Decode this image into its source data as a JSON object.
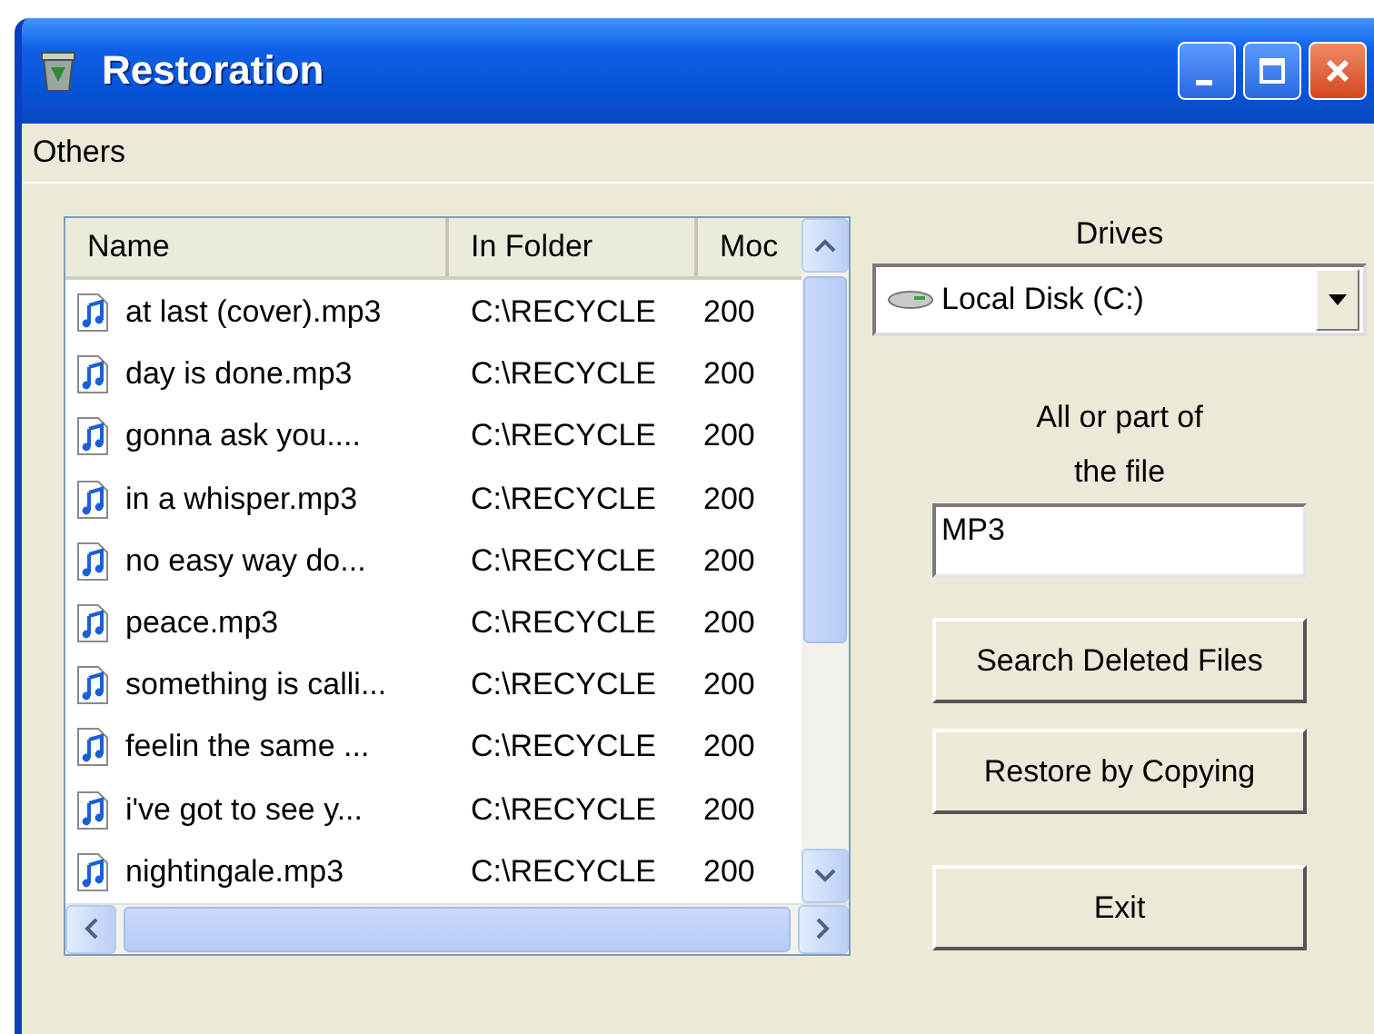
{
  "window": {
    "title": "Restoration"
  },
  "menu": [
    {
      "label": "Others"
    }
  ],
  "table": {
    "columns": [
      "Name",
      "In Folder",
      "Moc"
    ],
    "rows": [
      {
        "cells": [
          "at last (cover).mp3",
          "C:\\RECYCLE",
          "200"
        ]
      },
      {
        "cells": [
          "day is done.mp3",
          "C:\\RECYCLE",
          "200"
        ]
      },
      {
        "cells": [
          "gonna ask you....",
          "C:\\RECYCLE",
          "200"
        ]
      },
      {
        "cells": [
          "in a whisper.mp3",
          "C:\\RECYCLE",
          "200"
        ]
      },
      {
        "cells": [
          "no easy way do...",
          "C:\\RECYCLE",
          "200"
        ]
      },
      {
        "cells": [
          "peace.mp3",
          "C:\\RECYCLE",
          "200"
        ]
      },
      {
        "cells": [
          "something is calli...",
          "C:\\RECYCLE",
          "200"
        ]
      },
      {
        "cells": [
          "feelin the same ...",
          "C:\\RECYCLE",
          "200"
        ]
      },
      {
        "cells": [
          "i've got to see y...",
          "C:\\RECYCLE",
          "200"
        ]
      },
      {
        "cells": [
          "nightingale.mp3",
          "C:\\RECYCLE",
          "200"
        ]
      }
    ]
  },
  "drives": {
    "label": "Drives",
    "value": "Local Disk (C:)"
  },
  "search": {
    "label": "All or part of the file",
    "value": "MP3"
  },
  "buttons": [
    "Search Deleted Files",
    "Restore by Copying",
    "Exit"
  ]
}
